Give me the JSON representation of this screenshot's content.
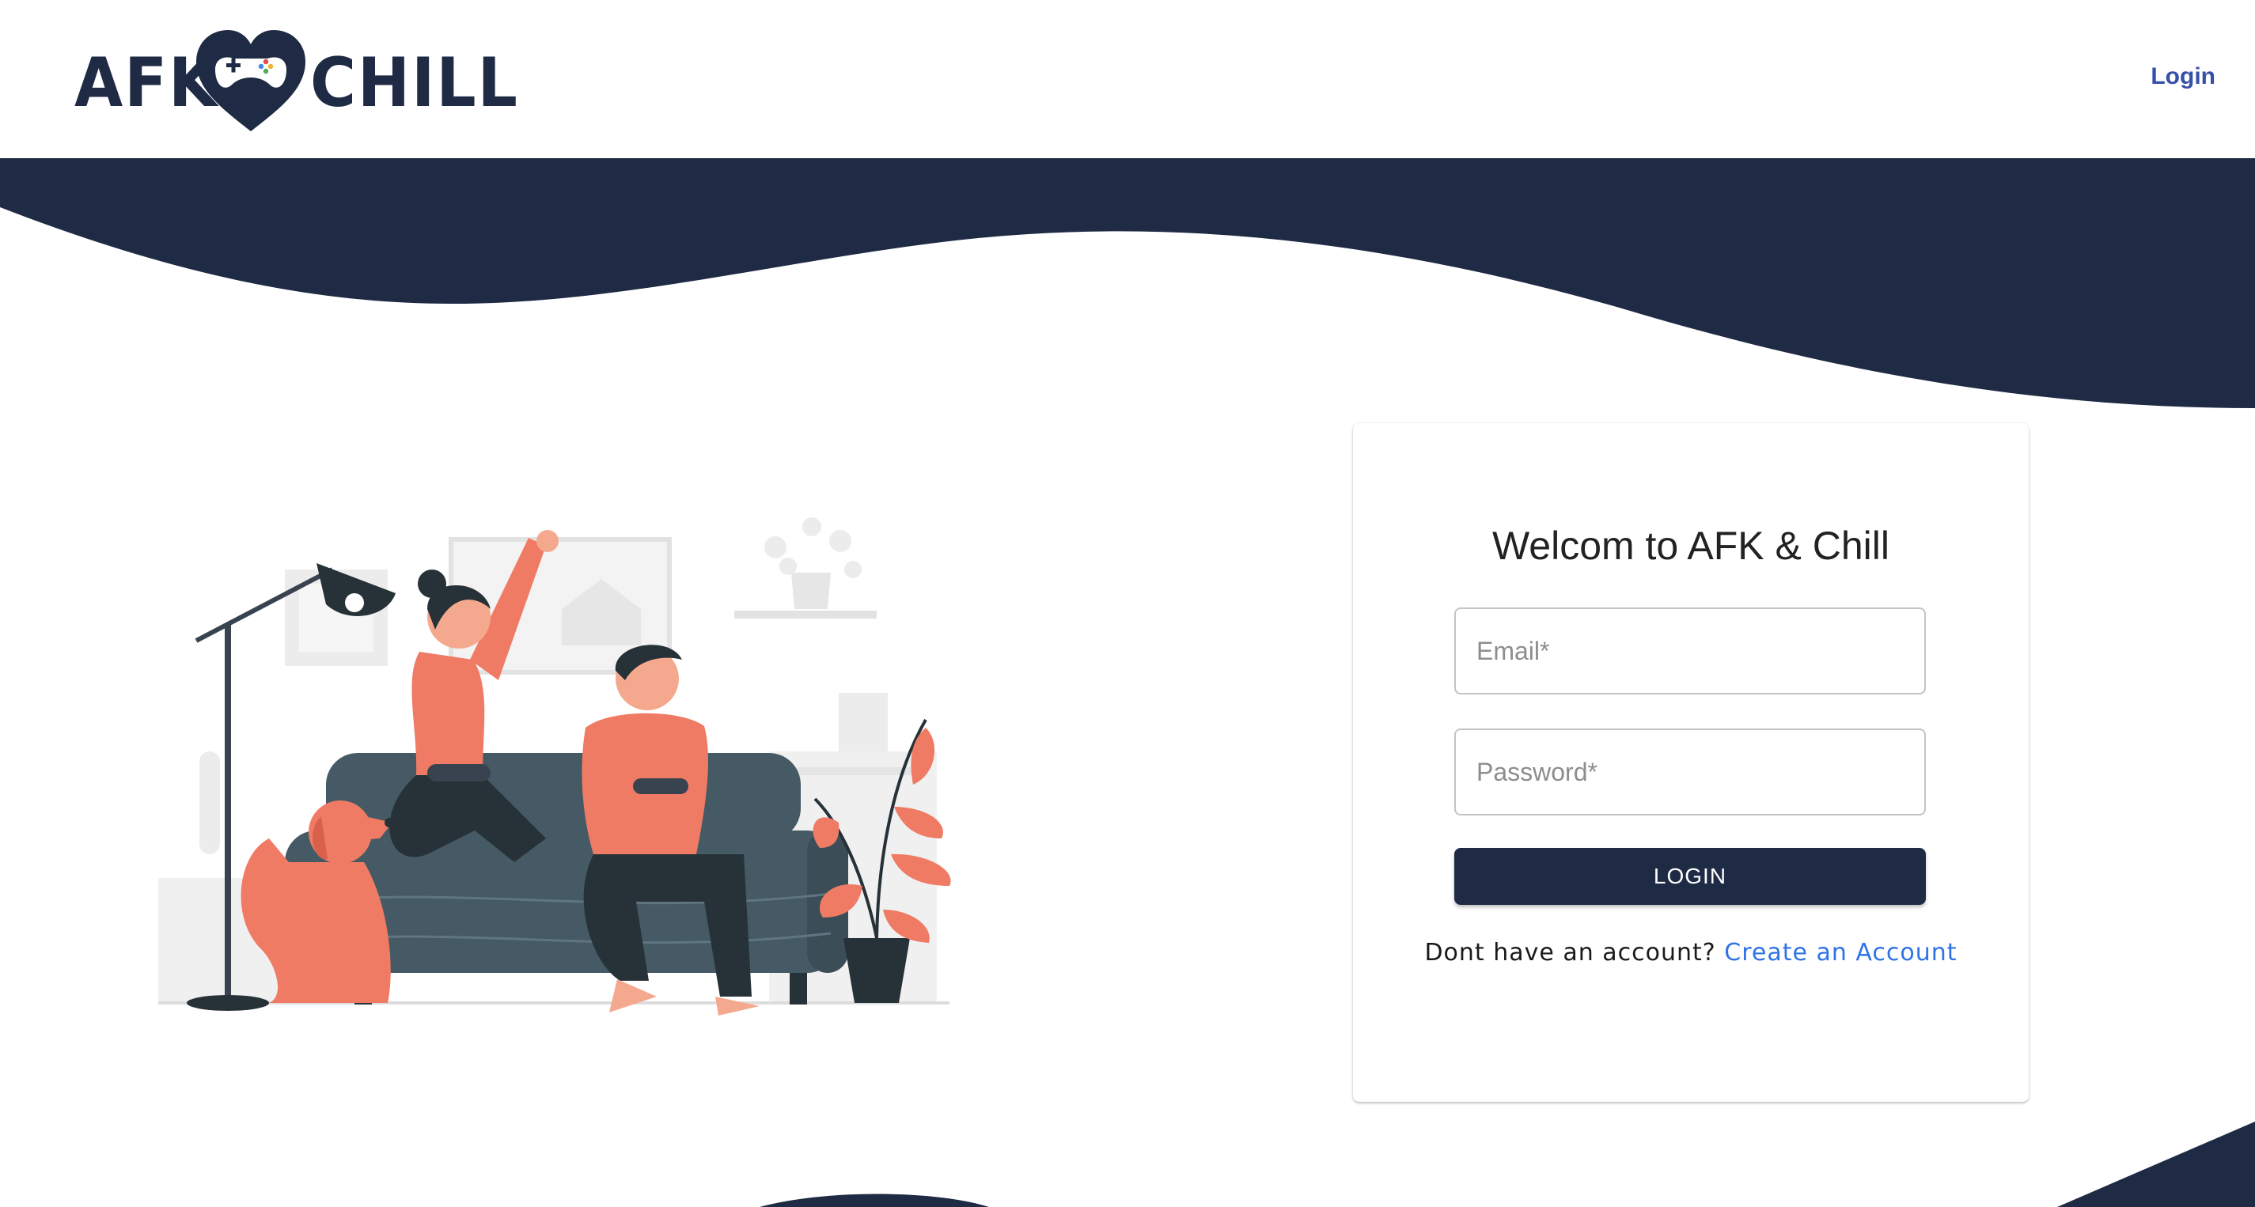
{
  "brand": {
    "logo_left": "AFK",
    "logo_right": "CHILL",
    "logo_icon": "heart-controller-icon",
    "navy": "#1f2b44",
    "accent": "#f07b65"
  },
  "nav": {
    "login_label": "Login"
  },
  "login_card": {
    "title": "Welcom to AFK & Chill",
    "email": {
      "placeholder": "Email*",
      "value": ""
    },
    "password": {
      "placeholder": "Password*",
      "value": ""
    },
    "submit_label": "LOGIN",
    "signup_prompt": "Dont have an account?",
    "signup_link": "Create an Account",
    "link_color": "#2f73e6"
  },
  "illustration": {
    "subject": "couple-gaming-on-couch-illustration"
  }
}
